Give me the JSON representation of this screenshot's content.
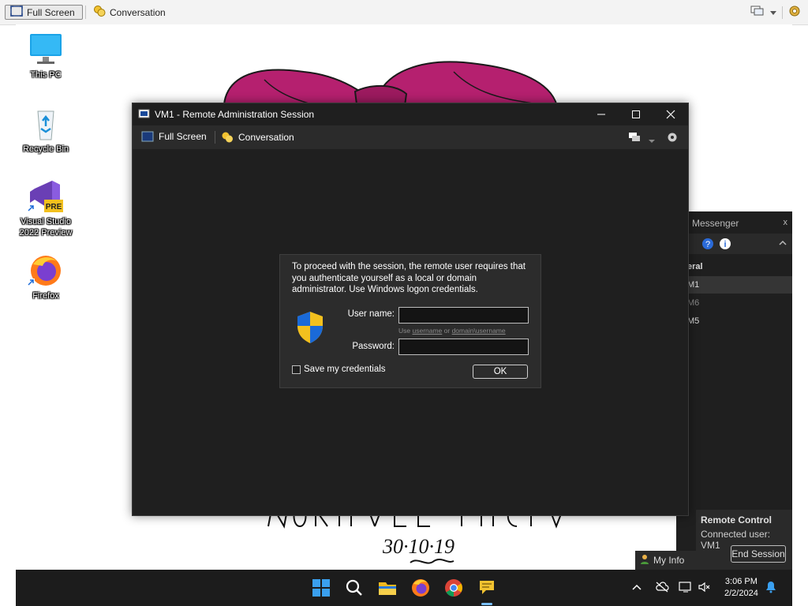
{
  "host_toolbar": {
    "fullscreen_label": "Full Screen",
    "conversation_label": "Conversation",
    "icons": [
      "fullscreen-icon",
      "conversation-icon",
      "monitor-icon",
      "dropdown-icon",
      "settings-icon"
    ]
  },
  "desktop": {
    "icons": [
      {
        "label": "This PC",
        "icon": "monitor-icon"
      },
      {
        "label": "Recycle Bin",
        "icon": "recycle-bin-icon"
      },
      {
        "label": "Visual Studio 2022 Preview",
        "badge": "PRE",
        "icon": "visual-studio-icon"
      },
      {
        "label": "Firefox",
        "icon": "firefox-icon"
      }
    ],
    "handwriting_text": "30·10·19"
  },
  "session_window": {
    "title": "VM1 - Remote Administration Session",
    "toolbar": {
      "fullscreen_label": "Full Screen",
      "conversation_label": "Conversation"
    }
  },
  "auth_dialog": {
    "message": "To proceed with the session, the remote user requires that you authenticate yourself as a local or domain administrator. Use Windows logon credentials.",
    "username_label": "User name:",
    "username_value": "",
    "hint_prefix": "Use ",
    "hint_user": "username",
    "hint_or": " or ",
    "hint_domain": "domain\\username",
    "password_label": "Password:",
    "password_value": "",
    "save_label": "Save my credentials",
    "save_checked": false,
    "ok_label": "OK"
  },
  "messenger": {
    "title": "Messenger",
    "close_label": "x",
    "group_label": "eral",
    "items": [
      "M1",
      "M6",
      "M5"
    ]
  },
  "remote_control": {
    "title": "Remote Control",
    "connected_text": "Connected user: VM1",
    "end_button": "End Session"
  },
  "my_info_label": "My Info",
  "taskbar": {
    "apps": [
      "windows-start-icon",
      "search-icon",
      "file-explorer-icon",
      "firefox-icon",
      "chrome-icon",
      "messenger-app-icon"
    ],
    "time": "3:06 PM",
    "date": "2/2/2024"
  }
}
